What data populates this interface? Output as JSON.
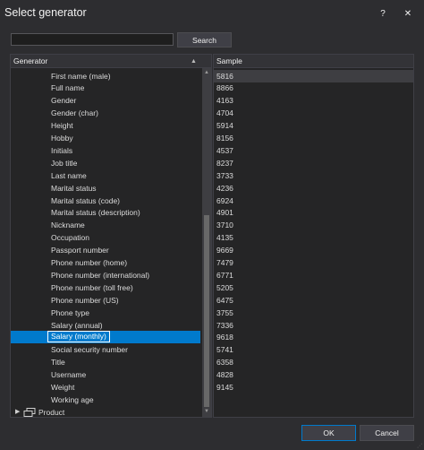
{
  "window": {
    "title": "Select generator",
    "help_label": "?",
    "close_label": "✕"
  },
  "search": {
    "value": "",
    "button_label": "Search"
  },
  "generator_header": "Generator",
  "sample_header": "Sample",
  "generators": [
    "First name (male)",
    "Full name",
    "Gender",
    "Gender (char)",
    "Height",
    "Hobby",
    "Initials",
    "Job title",
    "Last name",
    "Marital status",
    "Marital status (code)",
    "Marital status (description)",
    "Nickname",
    "Occupation",
    "Passport number",
    "Phone number (home)",
    "Phone number (international)",
    "Phone number (toll free)",
    "Phone number (US)",
    "Phone type",
    "Salary (annual)",
    "Salary (monthly)",
    "Social security number",
    "Title",
    "Username",
    "Weight",
    "Working age"
  ],
  "selected_generator": "Salary (monthly)",
  "group": {
    "label": "Product",
    "expanded": false
  },
  "samples": [
    "5816",
    "8866",
    "4163",
    "4704",
    "5914",
    "8156",
    "4537",
    "8237",
    "3733",
    "4236",
    "6924",
    "4901",
    "3710",
    "4135",
    "9669",
    "7479",
    "6771",
    "5205",
    "6475",
    "3755",
    "7336",
    "9618",
    "5741",
    "6358",
    "4828",
    "9145"
  ],
  "buttons": {
    "ok": "OK",
    "cancel": "Cancel"
  },
  "colors": {
    "background": "#2d2d30",
    "panel": "#252526",
    "selection": "#007acc",
    "text": "#dcdcdc"
  }
}
